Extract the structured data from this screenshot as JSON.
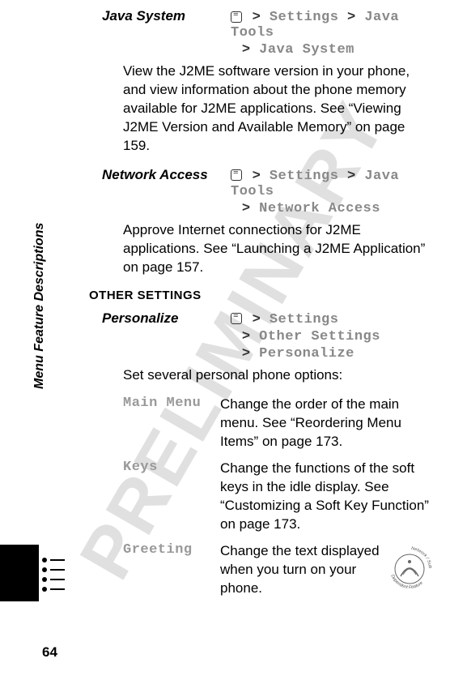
{
  "watermark": "PRELIMINARY",
  "sidebar_title": "Menu Feature Descriptions",
  "page_number": "64",
  "items": {
    "java_system": {
      "label": "Java System",
      "path": {
        "p1": "Settings",
        "p2": "Java Tools",
        "p3": "Java System"
      },
      "body": "View the J2ME software version in your phone, and view information about the phone memory available for J2ME applications. See “Viewing J2ME Version and Available Memory” on page 159."
    },
    "network_access": {
      "label": "Network Access",
      "path": {
        "p1": "Settings",
        "p2": "Java Tools",
        "p3": "Network Access"
      },
      "body": "Approve Internet connections for J2ME applications. See “Launching a J2ME Application” on page 157."
    },
    "other_settings_header": "OTHER SETTINGS",
    "personalize": {
      "label": "Personalize",
      "path": {
        "p1": "Settings",
        "p2": "Other Settings",
        "p3": "Personalize"
      },
      "body": "Set several personal phone options:"
    },
    "sub": {
      "main_menu": {
        "label": "Main Menu",
        "desc": "Change the order of the main menu. See “Reordering Menu Items” on page 173."
      },
      "keys": {
        "label": "Keys",
        "desc": "Change the functions of the soft keys in the idle display. See “Customizing a Soft Key Function” on page 173."
      },
      "greeting": {
        "label": "Greeting",
        "desc": "Change the text displayed when you turn on your phone."
      }
    },
    "badge_text": {
      "top": "Network / Subscription",
      "bottom": "Dependent Feature"
    }
  }
}
